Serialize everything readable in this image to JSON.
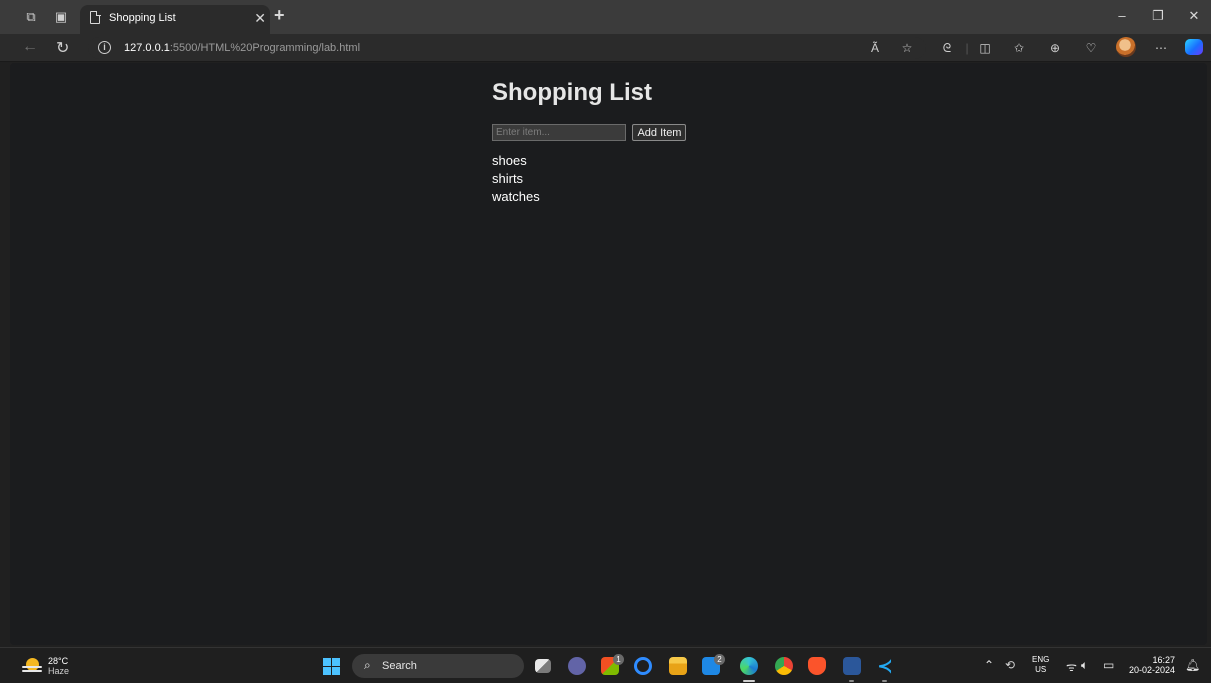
{
  "browser": {
    "tab_title": "Shopping List",
    "url_host": "127.0.0.1",
    "url_path": ":5500/HTML%20Programming/lab.html",
    "read_aloud_label": "Ã"
  },
  "page": {
    "heading": "Shopping List",
    "input_placeholder": "Enter item...",
    "add_button_label": "Add Item",
    "items": [
      "shoes",
      "shirts",
      "watches"
    ]
  },
  "taskbar": {
    "temperature": "28°C",
    "condition": "Haze",
    "search_label": "Search",
    "badges": [
      "1",
      "2"
    ],
    "lang_top": "ENG",
    "lang_bottom": "US",
    "time": "16:27",
    "date": "20-02-2024"
  },
  "colors": {
    "page_bg": "#1b1c1e",
    "chrome_bg": "#2b2b2b",
    "taskbar_bg": "#1f1f1f",
    "accent": "#4cc2ff"
  }
}
